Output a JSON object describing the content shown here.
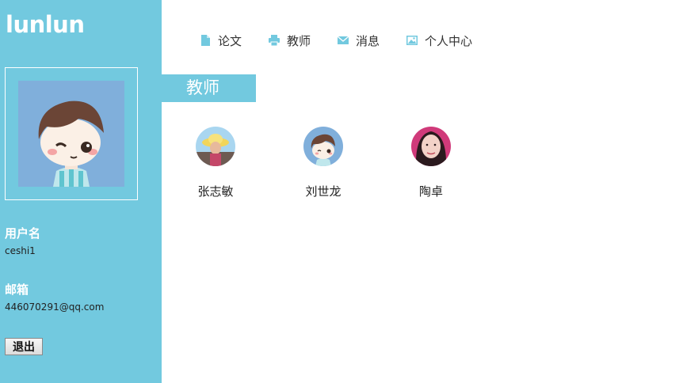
{
  "app": {
    "logo": "lunlun"
  },
  "profile": {
    "username_label": "用户名",
    "username": "ceshi1",
    "email_label": "邮箱",
    "email": "446070291@qq.com",
    "logout_label": "退出"
  },
  "nav": {
    "items": [
      {
        "label": "论文",
        "icon": "document-icon"
      },
      {
        "label": "教师",
        "icon": "printer-icon"
      },
      {
        "label": "消息",
        "icon": "envelope-icon"
      },
      {
        "label": "个人中心",
        "icon": "picture-icon"
      }
    ]
  },
  "main": {
    "section_title": "教师",
    "teachers": [
      {
        "name": "张志敏"
      },
      {
        "name": "刘世龙"
      },
      {
        "name": "陶卓"
      }
    ]
  },
  "colors": {
    "accent": "#72c9df",
    "text": "#333333"
  }
}
